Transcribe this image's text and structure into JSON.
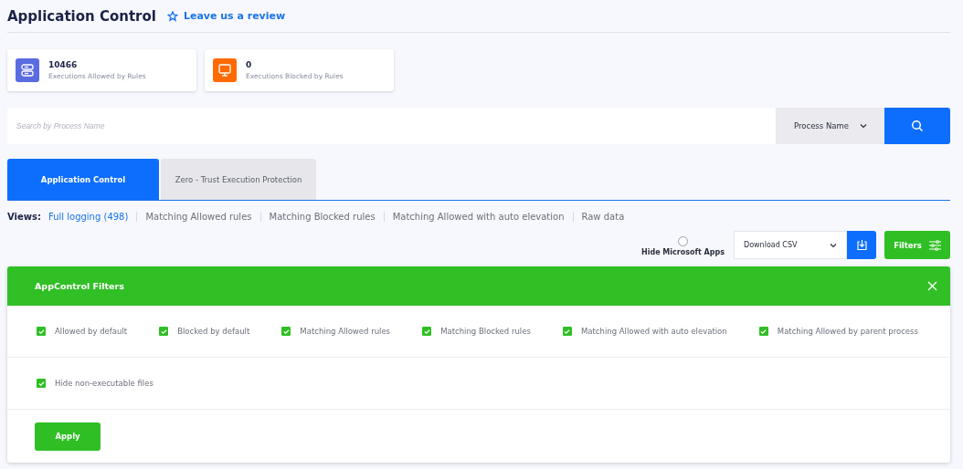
{
  "header": {
    "title": "Application Control",
    "review_link": "Leave us a review"
  },
  "stats": [
    {
      "value": "10466",
      "label": "Executions Allowed by Rules",
      "kind": "allowed"
    },
    {
      "value": "0",
      "label": "Executions Blocked by Rules",
      "kind": "blocked"
    }
  ],
  "search": {
    "placeholder": "Search by Process Name",
    "field_select": "Process Name"
  },
  "tabs": [
    {
      "label": "Application Control",
      "selected": true
    },
    {
      "label": "Zero - Trust Execution Protection",
      "selected": false
    }
  ],
  "views": {
    "label": "Views:",
    "items": [
      {
        "label": "Full logging (498)",
        "selected": true
      },
      {
        "label": "Matching Allowed rules",
        "selected": false
      },
      {
        "label": "Matching Blocked rules",
        "selected": false
      },
      {
        "label": "Matching Allowed with auto elevation",
        "selected": false
      },
      {
        "label": "Raw data",
        "selected": false
      }
    ]
  },
  "toolbar": {
    "hide_microsoft_apps": {
      "label": "Hide Microsoft Apps",
      "checked": false
    },
    "download_select": "Download CSV",
    "filters_button": "Filters"
  },
  "filters_panel": {
    "title": "AppControl Filters",
    "rows": [
      [
        {
          "label": "Allowed by default",
          "checked": true
        },
        {
          "label": "Blocked by default",
          "checked": true
        },
        {
          "label": "Matching Allowed rules",
          "checked": true
        },
        {
          "label": "Matching Blocked rules",
          "checked": true
        },
        {
          "label": "Matching Allowed with auto elevation",
          "checked": true
        },
        {
          "label": "Matching Allowed by parent process",
          "checked": true
        }
      ],
      [
        {
          "label": "Hide non-executable files",
          "checked": true
        }
      ]
    ],
    "apply_button": "Apply"
  }
}
